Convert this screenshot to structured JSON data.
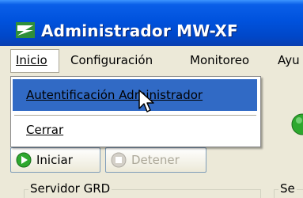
{
  "window": {
    "title": "Administrador MW-XF",
    "icon": "app-logo-icon"
  },
  "menubar": {
    "items": [
      {
        "label": "Inicio"
      },
      {
        "label": "Configuración"
      },
      {
        "label": "Monitoreo"
      },
      {
        "label": "Ayu"
      }
    ]
  },
  "dropdown": {
    "items": [
      {
        "label": "Autentificación Administrador",
        "highlighted": true
      },
      {
        "label": "Cerrar",
        "highlighted": false
      }
    ]
  },
  "toolbar": {
    "start_label": "Iniciar",
    "stop_label": "Detener",
    "start_icon": "play-icon",
    "stop_icon": "stop-icon"
  },
  "groups": [
    {
      "label": "Servidor GRD"
    },
    {
      "label": "Se"
    }
  ],
  "colors": {
    "titlebar": "#0052dd",
    "highlight": "#316ac5",
    "status_light": "#2ea82e"
  }
}
